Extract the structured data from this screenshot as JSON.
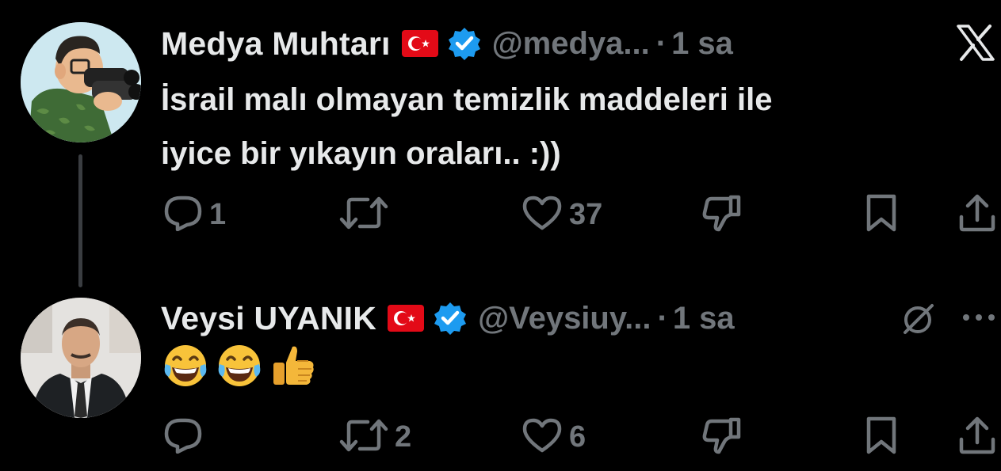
{
  "brand": {
    "x_logo": "x-logo-icon"
  },
  "colors": {
    "background": "#000000",
    "text_primary": "#e7e9ea",
    "text_secondary": "#71767b",
    "verified_blue": "#1d9bf0",
    "thread_line": "#3a3d41",
    "flag_red": "#e30a17"
  },
  "tweets": [
    {
      "display_name": "Medya Muhtarı",
      "flag_icon": "turkey-flag-icon",
      "verified_icon": "verified-badge-icon",
      "handle": "@medya...",
      "separator": "·",
      "time": "1 sa",
      "text_lines": [
        "İsrail malı olmayan temizlik maddeleri ile",
        "iyice bir yıkayın oraları.. :))"
      ],
      "actions": {
        "replies": "1",
        "retweets": "",
        "likes": "37",
        "dislike_icon": "dislike-icon",
        "bookmark_icon": "bookmark-icon",
        "share_icon": "share-icon"
      }
    },
    {
      "display_name": "Veysi UYANIK",
      "flag_icon": "turkey-flag-icon",
      "verified_icon": "verified-badge-icon",
      "handle": "@Veysiuy...",
      "separator": "·",
      "time": "1 sa",
      "emojis": [
        "😂",
        "😂",
        "👍"
      ],
      "actions": {
        "replies": "",
        "retweets": "2",
        "likes": "6",
        "dislike_icon": "dislike-icon",
        "bookmark_icon": "bookmark-icon",
        "share_icon": "share-icon"
      },
      "corner_icons": [
        "grok-icon",
        "more-icon"
      ]
    }
  ]
}
